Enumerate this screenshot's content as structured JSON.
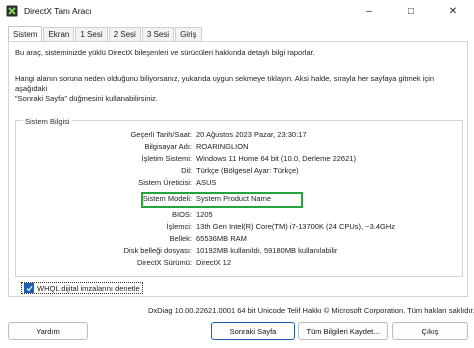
{
  "window": {
    "title": "DirectX Tanı Aracı"
  },
  "tabs": [
    "Sistem",
    "Ekran",
    "1 Sesi",
    "2 Sesi",
    "3 Sesi",
    "Giriş"
  ],
  "description1": "Bu araç, sisteminizde yüklü DirectX bileşenleri ve sürücüleri hakkında detaylı bilgi raporlar.",
  "description2_line1": "Hangi alanın soruna neden olduğunu biliyorsanız, yukarıda uygun sekmeye tıklayın. Aksi halde, sırayla her sayfaya gitmek için aşağıdaki",
  "description2_line2": "\"Sonraki Sayfa\" düğmesini kullanabilirsiniz.",
  "group_title": "Sistem Bilgisi",
  "info": [
    {
      "label": "Geçerli Tarih/Saat:",
      "value": "20 Ağustos 2023 Pazar, 23:30:17"
    },
    {
      "label": "Bilgisayar Adı:",
      "value": "ROARINGLION"
    },
    {
      "label": "İşletim Sistemi:",
      "value": "Windows 11 Home 64 bit (10.0, Derleme 22621)"
    },
    {
      "label": "Dil:",
      "value": "Türkçe (Bölgesel Ayar: Türkçe)"
    },
    {
      "label": "Sistem Üreticisi:",
      "value": "ASUS"
    },
    {
      "label": "Sistem Modeli:",
      "value": "System Product Name"
    },
    {
      "label": "BIOS:",
      "value": "1205"
    },
    {
      "label": "İşlemci:",
      "value": "13th Gen Intel(R) Core(TM) i7-13700K (24 CPUs), ~3.4GHz"
    },
    {
      "label": "Bellek:",
      "value": "65536MB RAM"
    },
    {
      "label": "Disk belleği dosyası:",
      "value": "10192MB kullanıldı, 59180MB kullanılabilir"
    },
    {
      "label": "DirectX Sürümü:",
      "value": "DirectX 12"
    }
  ],
  "whql_label": "WHQL dijital imzalarını denetle",
  "whql_checked": true,
  "footer_info": "DxDiag 10.00.22621.0001 64 bit Unicode   Telif Hakkı © Microsoft Corporation. Tüm hakları saklıdır.",
  "buttons": {
    "help": "Yardım",
    "next_page": "Sonraki Sayfa",
    "save_all": "Tüm Bilgileri Kaydet...",
    "exit": "Çıkış"
  },
  "colors": {
    "highlight": "#23a43c",
    "checkbox": "#1a5fb4"
  }
}
